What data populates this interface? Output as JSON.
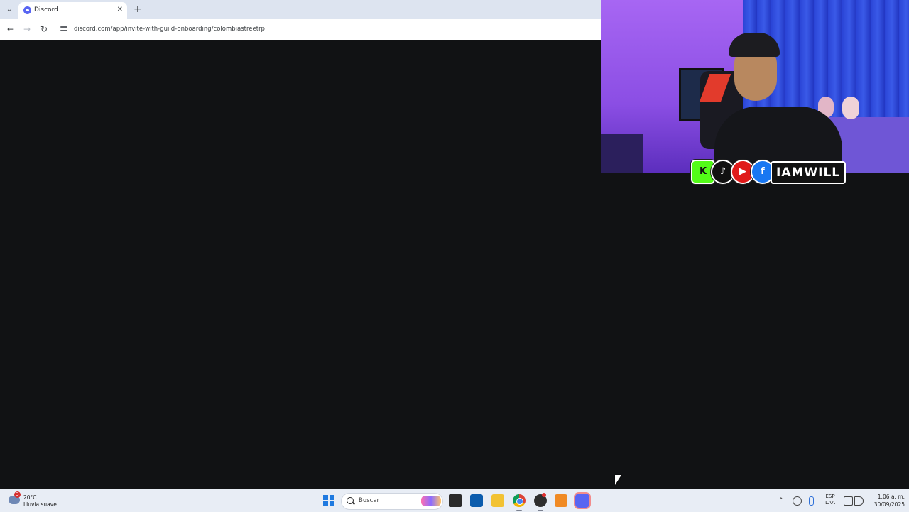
{
  "browser": {
    "tab": {
      "title": "Discord",
      "favicon": "discord-icon",
      "close_icon": "close-icon"
    },
    "new_tab_icon": "plus-icon",
    "toolbar": {
      "back_icon": "arrow-left-icon",
      "forward_icon": "arrow-right-icon",
      "reload_icon": "reload-icon",
      "site_info_icon": "tune-icon",
      "url": "discord.com/app/invite-with-guild-onboarding/colombiastreetrp"
    },
    "content_background": "#111214"
  },
  "webcam": {
    "social_icons": [
      "kick-icon",
      "tiktok-icon",
      "youtube-icon",
      "facebook-icon"
    ],
    "handle": "IAMWILL"
  },
  "taskbar": {
    "weather": {
      "badge": "3",
      "temp": "20°C",
      "desc": "Lluvia suave"
    },
    "search_placeholder": "Buscar",
    "apps": [
      "start-icon",
      "task-view-icon",
      "store-icon",
      "file-explorer-icon",
      "chrome-icon",
      "obs-icon",
      "orange-app-icon",
      "discord-icon"
    ],
    "tray": {
      "lang_top": "ESP",
      "lang_bottom": "LAA",
      "time": "1:06 a. m.",
      "date": "30/09/2025"
    }
  },
  "colors": {
    "discord_brand": "#5865f2",
    "taskbar_bg": "#e8edf5",
    "tabbar_bg": "#dde4f0"
  }
}
